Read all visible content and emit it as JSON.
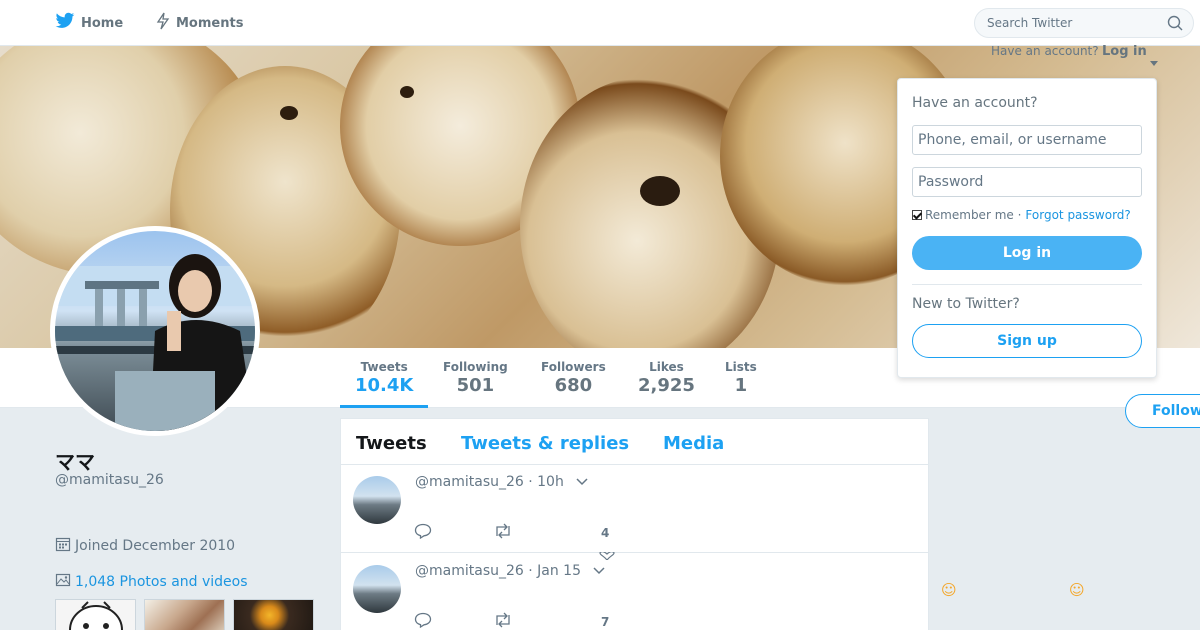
{
  "nav": {
    "home_label": "Home",
    "moments_label": "Moments"
  },
  "search": {
    "placeholder": "Search Twitter"
  },
  "login_menu": {
    "prompt": "Have an account?",
    "login_label": "Log in",
    "dropdown": {
      "title": "Have an account?",
      "username_placeholder": "Phone, email, or username",
      "password_placeholder": "Password",
      "remember_label": "Remember me",
      "separator": "·",
      "forgot_label": "Forgot password?",
      "login_button": "Log in",
      "new_prompt": "New to Twitter?",
      "signup_button": "Sign up"
    }
  },
  "profile": {
    "name": "ママ",
    "handle": "@mamitasu_26",
    "joined": "Joined December 2010",
    "photos_label": "1,048 Photos and videos",
    "follow_label": "Follow"
  },
  "stats": [
    {
      "label": "Tweets",
      "value": "10.4K"
    },
    {
      "label": "Following",
      "value": "501"
    },
    {
      "label": "Followers",
      "value": "680"
    },
    {
      "label": "Likes",
      "value": "2,925"
    },
    {
      "label": "Lists",
      "value": "1"
    }
  ],
  "timeline": {
    "tabs": [
      "Tweets",
      "Tweets & replies",
      "Media"
    ],
    "tweets": [
      {
        "handle": "@mamitasu_26",
        "time": "· 10h",
        "likes": "4"
      },
      {
        "handle": "@mamitasu_26",
        "time": "· Jan 15",
        "likes": "7"
      }
    ]
  },
  "emoji": [
    "☺",
    "☺"
  ],
  "colors": {
    "accent": "#1da1f2",
    "background": "#e6ecf0",
    "login_button": "#4ab3f4"
  },
  "icons": [
    "twitter-bird-icon",
    "bolt-icon",
    "search-icon",
    "calendar-icon",
    "photo-icon",
    "reply-icon",
    "retweet-icon",
    "heart-icon",
    "chevron-down-icon"
  ]
}
